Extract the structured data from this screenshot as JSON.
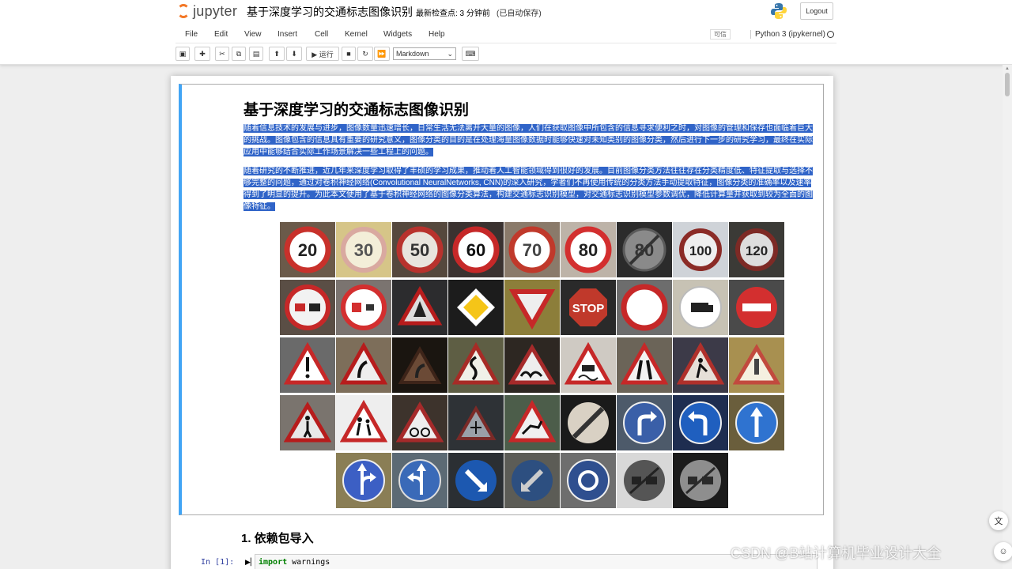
{
  "header": {
    "app_name": "jupyter",
    "notebook_title": "基于深度学习的交通标志图像识别",
    "checkpoint": "最新检查点: 3 分钟前",
    "autosave": "(已自动保存)",
    "logout_label": "Logout"
  },
  "menubar": {
    "items": [
      "File",
      "Edit",
      "View",
      "Insert",
      "Cell",
      "Kernel",
      "Widgets",
      "Help"
    ],
    "trusted_label": "可信",
    "kernel_name": "Python 3 (ipykernel)"
  },
  "toolbar": {
    "run_label": "▶ 运行",
    "cell_type": "Markdown"
  },
  "cell": {
    "heading": "基于深度学习的交通标志图像识别",
    "paragraph1": "随着信息技术的发展与进步，图像数量迅速增长，日常生活无法离开大量的图像，人们在获取图像中所包含的信息寻求便利之时，对图像的管理和保存也面临着巨大的挑战。图像包含的信息具有重要的研究意义，图像分类的目的是在处理海量图像数据时能够快速对未知类别的图像分类，然后进行下一步的研究学习，最终在实际应用中能够结合实际工作场景解决一些工程上的问题。",
    "paragraph2": "随着研究的不断推进，近几年来深度学习取得了丰硕的学习成果，推动着人工智能领域得到很好的发展。目前图像分类方法往往存在分类精度低、特征提取与选择不够完整的问题，通过对卷积神经网络(Convolutional NeuralNetworks, CNN)的深入研究，学者们不再使用传统的分类方法手动提取特征，图像分类的准确率以及速率得到了明显的提升。为此本文使用了基于卷积神经网络的图像分类算法，构建交通标志识别模型，对交通标志识别模型参数调优，降低计算量并获取到较为全面的图像特征。"
  },
  "speed_limits": [
    "20",
    "30",
    "50",
    "60",
    "70",
    "80",
    "80",
    "100",
    "120"
  ],
  "section": {
    "heading": "1. 依赖包导入",
    "prompt": "In [1]:",
    "code_keyword": "import",
    "code_rest": " warnings"
  },
  "watermark": "CSDN @B站计算机毕业设计大全"
}
